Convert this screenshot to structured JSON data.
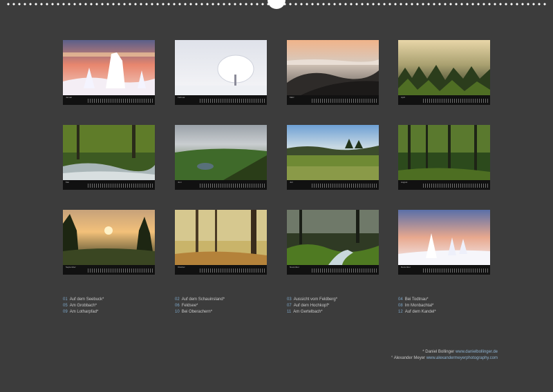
{
  "months": [
    {
      "label": "Januar",
      "caption": "Auf dem Seebuck*",
      "num": "01"
    },
    {
      "label": "Februar",
      "caption": "Auf dem Schauinsland*",
      "num": "02"
    },
    {
      "label": "März",
      "caption": "Aussicht vom Feldberg*",
      "num": "03"
    },
    {
      "label": "April",
      "caption": "Bei Todtnau*",
      "num": "04"
    },
    {
      "label": "Mai",
      "caption": "Am Grobbach*",
      "num": "05"
    },
    {
      "label": "Juni",
      "caption": "Feldsee*",
      "num": "06"
    },
    {
      "label": "Juli",
      "caption": "Auf dem Hochkopf*",
      "num": "07"
    },
    {
      "label": "August",
      "caption": "Im Monbachtal*",
      "num": "08"
    },
    {
      "label": "September",
      "caption": "Am Lotharpfad*",
      "num": "09"
    },
    {
      "label": "Oktober",
      "caption": "Bei Oberachern*",
      "num": "10"
    },
    {
      "label": "November",
      "caption": "Am Gertelbach*",
      "num": "11"
    },
    {
      "label": "Dezember",
      "caption": "Auf dem Kandel*",
      "num": "12"
    }
  ],
  "credits": [
    {
      "name": "* Daniel Bollinger",
      "url": "www.danielbollinger.de"
    },
    {
      "name": "° Alexander Meyer",
      "url": "www.alexandermeyerphotography.com"
    }
  ],
  "colors": {
    "background": "#3c3c3c",
    "caption_number": "#7da7c9"
  }
}
